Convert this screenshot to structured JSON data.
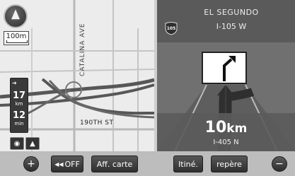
{
  "map": {
    "scale": "100m",
    "street_vertical": "CATALINA AVE",
    "street_horizontal": "190TH ST",
    "route_info": {
      "distance_value": "17",
      "distance_unit": "km",
      "time_value": "12",
      "time_unit": "min"
    },
    "icons": [
      "compass-icon",
      "zoom-in-icon",
      "zoom-out-icon",
      "voice-icon",
      "route-arrow-icon"
    ]
  },
  "guidance": {
    "city": "EL SEGUNDO",
    "shield_number": "105",
    "road": "I-105 W",
    "distance_value": "10",
    "distance_unit": "km",
    "next_road": "I-405 N"
  },
  "bottom_bar": {
    "off_label": "OFF",
    "map_display_label": "Aff. carte",
    "itinerary_label": "Itiné.",
    "marker_label": "repère"
  },
  "colors": {
    "road": "#575757",
    "map_background": "#ececec",
    "guidance_background": "#6d6d6d"
  }
}
